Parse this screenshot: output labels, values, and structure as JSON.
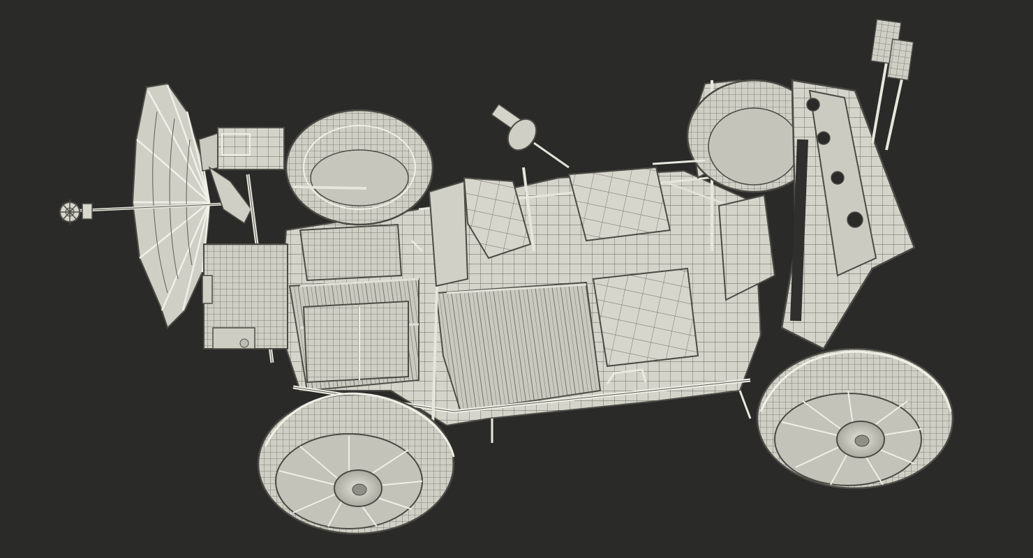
{
  "scene": {
    "subject": "lunar-roving-vehicle-wireframe",
    "background_color": "#2a2a29",
    "mesh_fill_color": "#d2d2c8",
    "mesh_shade_color": "#a6a69c",
    "mesh_line_color": "#5d5d56",
    "mesh_highlight_color": "#efefe6"
  }
}
